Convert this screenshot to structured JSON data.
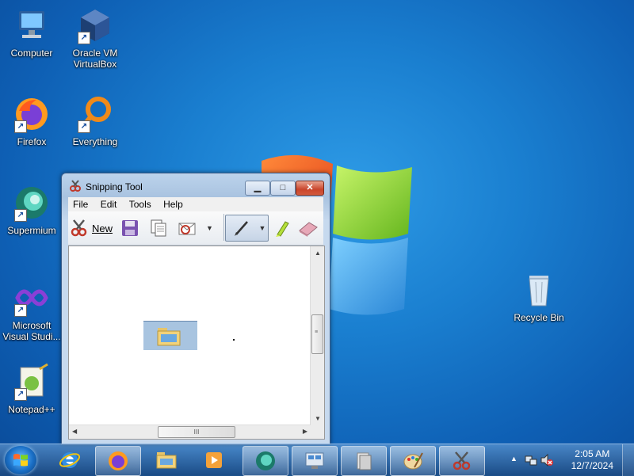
{
  "desktop": {
    "icons": [
      {
        "label_1": "Computer",
        "label_2": ""
      },
      {
        "label_1": "Oracle VM",
        "label_2": "VirtualBox"
      },
      {
        "label_1": "Firefox",
        "label_2": ""
      },
      {
        "label_1": "Everything",
        "label_2": ""
      },
      {
        "label_1": "Supermium",
        "label_2": ""
      },
      {
        "label_1": "Microsoft",
        "label_2": "Visual Studi..."
      },
      {
        "label_1": "Notepad++",
        "label_2": ""
      },
      {
        "label_1": "Recycle Bin",
        "label_2": ""
      }
    ]
  },
  "window": {
    "title": "Snipping Tool",
    "menu": [
      "File",
      "Edit",
      "Tools",
      "Help"
    ],
    "toolbar": {
      "new_label": "New"
    },
    "scrollbar_grip": "III"
  },
  "taskbar": {
    "clock_time": "2:05 AM",
    "clock_date": "12/7/2024"
  }
}
